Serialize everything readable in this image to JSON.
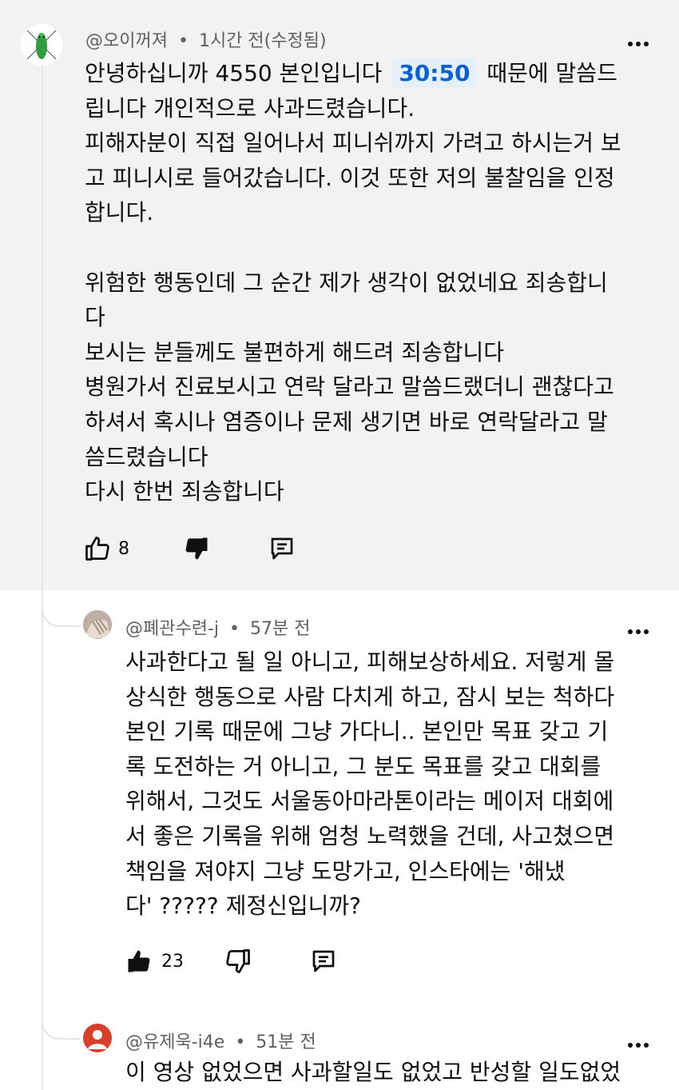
{
  "comments": [
    {
      "author": "@오이꺼져",
      "separator": "•",
      "time": "1시간 전(수정됨)",
      "avatar": "cucumber-avatar",
      "lines": [
        {
          "pre": "안녕하십니까 4550 본인입니다 ",
          "timestamp": "30:50",
          "post": " 때문에 말씀드"
        },
        {
          "text": "립니다 개인적으로 사과드렸습니다."
        },
        {
          "text": "피해자분이 직접 일어나서 피니쉬까지 가려고 하시는거 보"
        },
        {
          "text": "고 피니시로 들어갔습니다. 이것 또한 저의 불찰임을 인정"
        },
        {
          "text": "합니다."
        },
        {
          "text": ""
        },
        {
          "text": "위험한 행동인데 그 순간 제가 생각이 없었네요 죄송합니"
        },
        {
          "text": "다"
        },
        {
          "text": "보시는 분들께도 불편하게 해드려 죄송합니다"
        },
        {
          "text": "병원가서 진료보시고 연락 달라고 말씀드랬더니 괜찮다고"
        },
        {
          "text": "하셔서 혹시나 염증이나 문제 생기면 바로 연락달라고 말"
        },
        {
          "text": "씀드렸습니다"
        },
        {
          "text": "다시 한번 죄송합니다"
        }
      ],
      "likes": "8",
      "like_filled": false,
      "dislike_filled": true
    },
    {
      "author": "@폐관수련-j",
      "separator": "•",
      "time": "57분 전",
      "avatar": "photo-avatar",
      "lines": [
        {
          "text": "사과한다고 될 일 아니고, 피해보상하세요. 저렇게 몰"
        },
        {
          "text": "상식한 행동으로 사람 다치게 하고, 잠시 보는 척하다"
        },
        {
          "text": "본인 기록 때문에 그냥 가다니.. 본인만 목표 갖고 기"
        },
        {
          "text": "록 도전하는 거 아니고, 그 분도 목표를 갖고 대회를"
        },
        {
          "text": "위해서, 그것도 서울동아마라톤이라는 메이저 대회에"
        },
        {
          "text": "서 좋은 기록을 위해 엄청 노력했을 건데, 사고쳤으면"
        },
        {
          "text": "책임을 져야지 그냥 도망가고, 인스타에는 '해냈"
        },
        {
          "text": "다' ????? 제정신입니까?"
        }
      ],
      "likes": "23",
      "like_filled": true,
      "dislike_filled": false
    },
    {
      "author": "@유제욱-i4e",
      "separator": "•",
      "time": "51분 전",
      "avatar": "default-person-avatar",
      "avatar_color": "#d9402b",
      "lines": [
        {
          "text": "이 영상 없었으면 사과할일도 없었고 반성할 일도없었"
        }
      ]
    }
  ],
  "colors": {
    "timestamp_bg": "#e5f0fb",
    "timestamp_fg": "#065fd4",
    "top_bg": "#f2f2f2"
  }
}
